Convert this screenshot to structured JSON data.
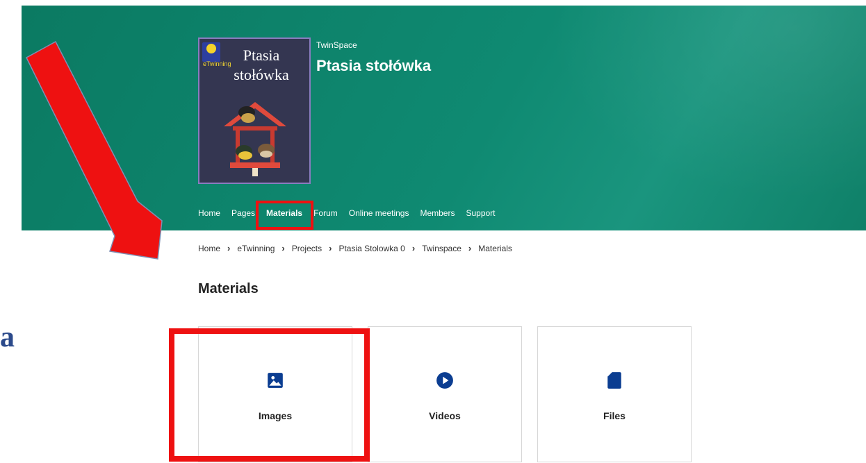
{
  "slide": {
    "partial_letter": "a"
  },
  "header": {
    "cover": {
      "title": "Ptasia stołówka",
      "logo_text": "eTwinning"
    },
    "space_label": "TwinSpace",
    "project_title": "Ptasia stołówka"
  },
  "nav": {
    "items": [
      {
        "label": "Home"
      },
      {
        "label": "Pages"
      },
      {
        "label": "Materials",
        "active": true
      },
      {
        "label": "Forum"
      },
      {
        "label": "Online meetings"
      },
      {
        "label": "Members"
      },
      {
        "label": "Support"
      }
    ]
  },
  "breadcrumb": {
    "items": [
      "Home",
      "eTwinning",
      "Projects",
      "Ptasia Stolowka 0",
      "Twinspace",
      "Materials"
    ]
  },
  "page_heading": "Materials",
  "cards": [
    {
      "label": "Images",
      "icon": "image-icon"
    },
    {
      "label": "Videos",
      "icon": "play-circle-icon"
    },
    {
      "label": "Files",
      "icon": "file-icon"
    }
  ],
  "colors": {
    "header_green": "#0f8a72",
    "highlight_red": "#ee1111",
    "icon_blue": "#0b3d91",
    "cover_purple": "#343651"
  }
}
